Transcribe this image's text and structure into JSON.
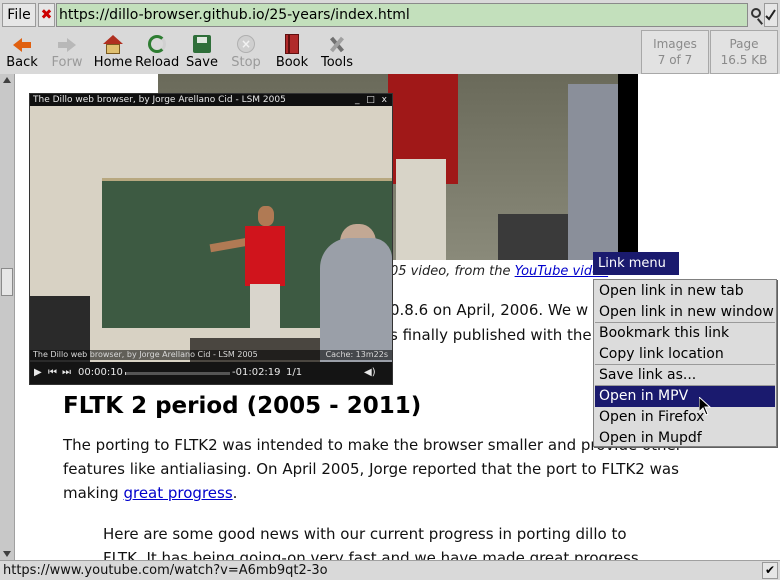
{
  "urlbar": {
    "file_label": "File",
    "clear_label": "✖",
    "url": "https://dillo-browser.github.io/25-years/index.html"
  },
  "toolbar": {
    "back_label": "Back",
    "forward_label": "Forw",
    "home_label": "Home",
    "reload_label": "Reload",
    "save_label": "Save",
    "stop_label": "Stop",
    "book_label": "Book",
    "tools_label": "Tools",
    "images": {
      "label": "Images",
      "value": "7 of 7"
    },
    "page": {
      "label": "Page",
      "value": "16.5 KB"
    }
  },
  "mpv": {
    "title": "The Dillo web browser, by Jorge Arellano Cid - LSM 2005",
    "window_buttons": "_ □ x",
    "overlay_title": "The Dillo web browser, by Jorge Arellano Cid - LSM 2005",
    "cache": "Cache: 13m22s",
    "time_elapsed": "00:00:10",
    "time_remaining": "-01:02:19",
    "chapter": "1/1",
    "seek_progress": 0.01
  },
  "content": {
    "caption_prefix": "05 video, from the ",
    "caption_link": "YouTube video",
    "para_line1": "0.8.6 on April, 2006. We w",
    "para_line2": "s finally published with the",
    "heading": "FLTK 2 period (2005 - 2011)",
    "body_line1": "The porting to FLTK2 was intended to make the browser smaller and provide other",
    "body_line2": "features like antialiasing. On April 2005, Jorge reported that the port to FLTK2 was",
    "body_line3_prefix": "making ",
    "body_line3_link": "great progress",
    "body_line3_suffix": ".",
    "quote_line1": "Here are some good news with our current progress in porting dillo to",
    "quote_line2": "FLTK. It has being going-on very fast and we have made great progress"
  },
  "link_menu": {
    "title": "Link menu",
    "items": [
      "Open link in new tab",
      "Open link in new window",
      "Bookmark this link",
      "Copy link location",
      "Save link as...",
      "Open in MPV",
      "Open in Firefox",
      "Open in Mupdf"
    ],
    "active_item": "Open in MPV"
  },
  "statusbar": {
    "text": "https://www.youtube.com/watch?v=A6mb9qt2-3o",
    "bug_icon": "✔"
  }
}
